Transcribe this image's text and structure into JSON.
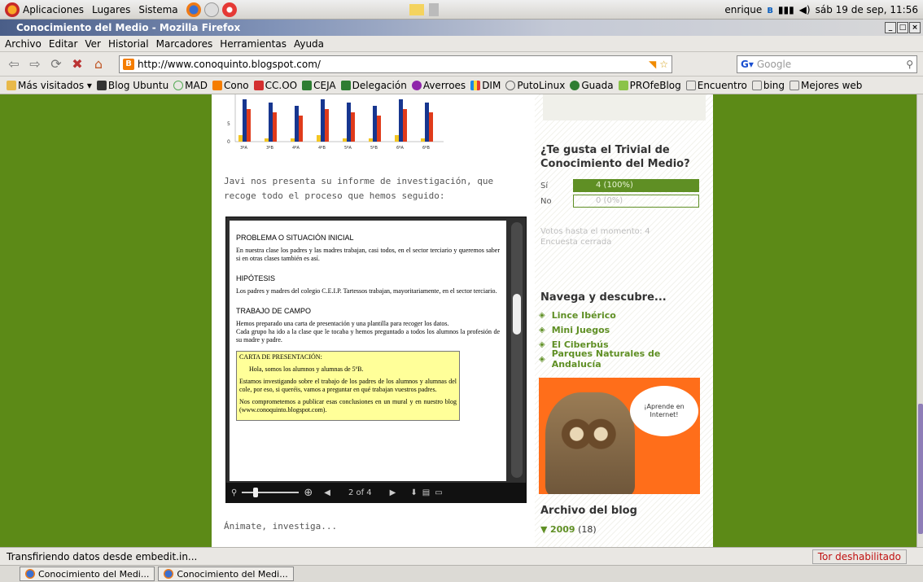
{
  "panel": {
    "menus": [
      "Aplicaciones",
      "Lugares",
      "Sistema"
    ],
    "user": "enrique",
    "clock": "sáb 19 de sep, 11:56"
  },
  "window": {
    "title": "Conocimiento del Medio - Mozilla Firefox"
  },
  "menubar": [
    "Archivo",
    "Editar",
    "Ver",
    "Historial",
    "Marcadores",
    "Herramientas",
    "Ayuda"
  ],
  "nav": {
    "url": "http://www.conoquinto.blogspot.com/",
    "search_placeholder": "Google"
  },
  "bookmarks": [
    "Más visitados ▾",
    "Blog Ubuntu",
    "MAD",
    "Cono",
    "CC.OO",
    "CEJA",
    "Delegación",
    "Averroes",
    "DIM",
    "PutoLinux",
    "Guada",
    "PROfeBlog",
    "Encuentro",
    "bing",
    "Mejores web"
  ],
  "chart_partial": {
    "categories": [
      "3ºA",
      "3ºB",
      "4ºA",
      "4ºB",
      "5ºA",
      "5ºB",
      "6ºA",
      "6ºB"
    ],
    "y_ticks": [
      "5",
      "0"
    ]
  },
  "post": {
    "intro": "Javi nos presenta su informe de investigación, que recoge todo el proceso que hemos seguido:",
    "outro": "Ánimate, investiga..."
  },
  "doc": {
    "h1": "PROBLEMA O SITUACIÓN INICIAL",
    "p1": "En nuestra clase los padres y las madres trabajan, casi todos, en el sector terciario y queremos saber si en otras clases también es así.",
    "h2": "HIPÓTESIS",
    "p2": "Los padres y madres del colegio C.E.I.P. Tartessos trabajan, mayoritariamente, en el sector terciario.",
    "h3": "TRABAJO DE CAMPO",
    "p3": "Hemos preparado una carta de presentación y una plantilla para recoger los datos.",
    "p4": "Cada grupo ha ido a la clase que le tocaba y hemos preguntado a todos los alumnos la profesión de su madre y padre.",
    "carta_title": "CARTA DE PRESENTACIÓN:",
    "carta_1": "Hola, somos los alumnos y alumnas de 5ºB.",
    "carta_2": "Estamos investigando sobre el trabajo de los padres de los alumnos y alumnas del cole, por eso, si queréis, vamos a preguntar en qué trabajan vuestros padres.",
    "carta_3": "Nos comprometemos a publicar esas conclusiones en un mural y en nuestro blog (www.conoquinto.blogspot.com)."
  },
  "viewer": {
    "page_indicator": "2 of 4"
  },
  "poll": {
    "title": "¿Te gusta el Trivial de Conocimiento del Medio?",
    "options": [
      {
        "label": "Sí",
        "result": "4 (100%)",
        "fraction": 1.0
      },
      {
        "label": "No",
        "result": "0 (0%)",
        "fraction": 0.0
      }
    ],
    "votes": "Votos hasta el momento: 4",
    "status": "Encuesta cerrada"
  },
  "nav_section": {
    "title": "Navega y descubre...",
    "links": [
      "Lince Ibérico",
      "Mini Juegos",
      "El Ciberbús",
      "Parques Naturales de Andalucía"
    ]
  },
  "banner": {
    "bubble": "¡Aprende en Internet!"
  },
  "archive": {
    "title": "Archivo del blog",
    "year": "2009",
    "count": "(18)"
  },
  "status": {
    "text": "Transfiriendo datos desde embedit.in...",
    "tor": "Tor deshabilitado"
  },
  "taskbar": [
    "Conocimiento del Medi...",
    "Conocimiento del Medi..."
  ]
}
